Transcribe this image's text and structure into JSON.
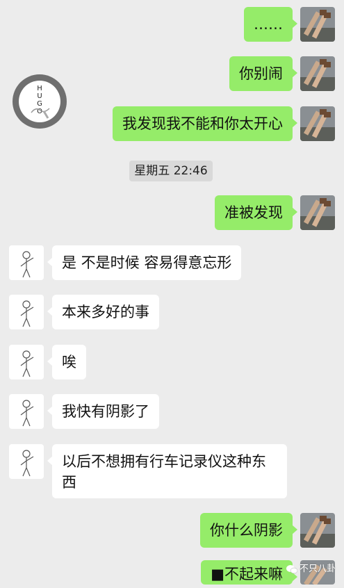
{
  "chat": {
    "timestamp": "星期五 22:46",
    "messages": [
      {
        "sender": "me",
        "text": "……"
      },
      {
        "sender": "me",
        "text": "你别闹"
      },
      {
        "sender": "me",
        "text": "我发现我不能和你太开心"
      },
      {
        "sender": "me",
        "text": "准被发现"
      },
      {
        "sender": "them",
        "text": "是 不是时候 容易得意忘形"
      },
      {
        "sender": "them",
        "text": "本来多好的事"
      },
      {
        "sender": "them",
        "text": "唉"
      },
      {
        "sender": "them",
        "text": "我快有阴影了"
      },
      {
        "sender": "them",
        "text": "以后不想拥有行车记录仪这种东西"
      },
      {
        "sender": "me",
        "text": "你什么阴影"
      },
      {
        "sender": "me",
        "text": "■不起来嘛"
      }
    ]
  },
  "decoration": {
    "hugo_letters": "HUGO"
  },
  "watermark": {
    "text": "不只八卦"
  },
  "colors": {
    "background": "#ececec",
    "my_bubble": "#95ec69",
    "their_bubble": "#ffffff",
    "timestamp_bg": "#d9d9d9"
  }
}
